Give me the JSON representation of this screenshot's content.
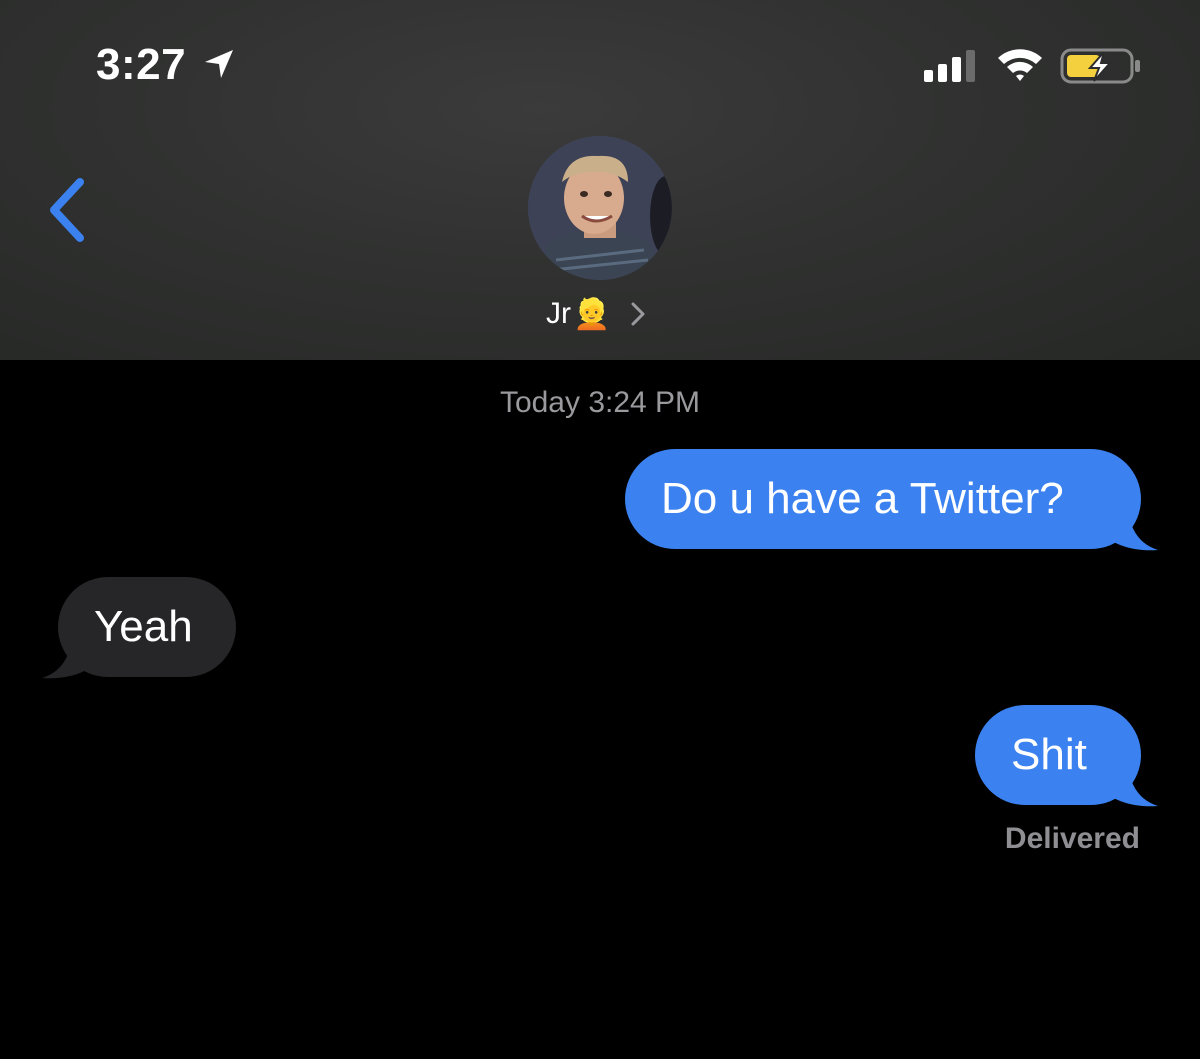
{
  "status_bar": {
    "time": "3:27",
    "location_icon": "location-arrow-icon",
    "signal_icon": "cellular-signal-icon",
    "wifi_icon": "wifi-icon",
    "battery_icon": "battery-charging-icon",
    "battery_color": "#f4d03f"
  },
  "header": {
    "back_icon": "chevron-left-icon",
    "contact_name": "Jr",
    "contact_emoji": "👱",
    "details_icon": "chevron-right-icon"
  },
  "conversation": {
    "timestamp": "Today 3:24 PM",
    "messages": [
      {
        "direction": "sent",
        "text": "Do u have a Twitter?"
      },
      {
        "direction": "received",
        "text": "Yeah"
      },
      {
        "direction": "sent",
        "text": "Shit"
      }
    ],
    "status": "Delivered"
  },
  "colors": {
    "accent": "#3b82f0",
    "sent_bubble": "#3b82f0",
    "received_bubble": "#262628",
    "background": "#000000"
  }
}
